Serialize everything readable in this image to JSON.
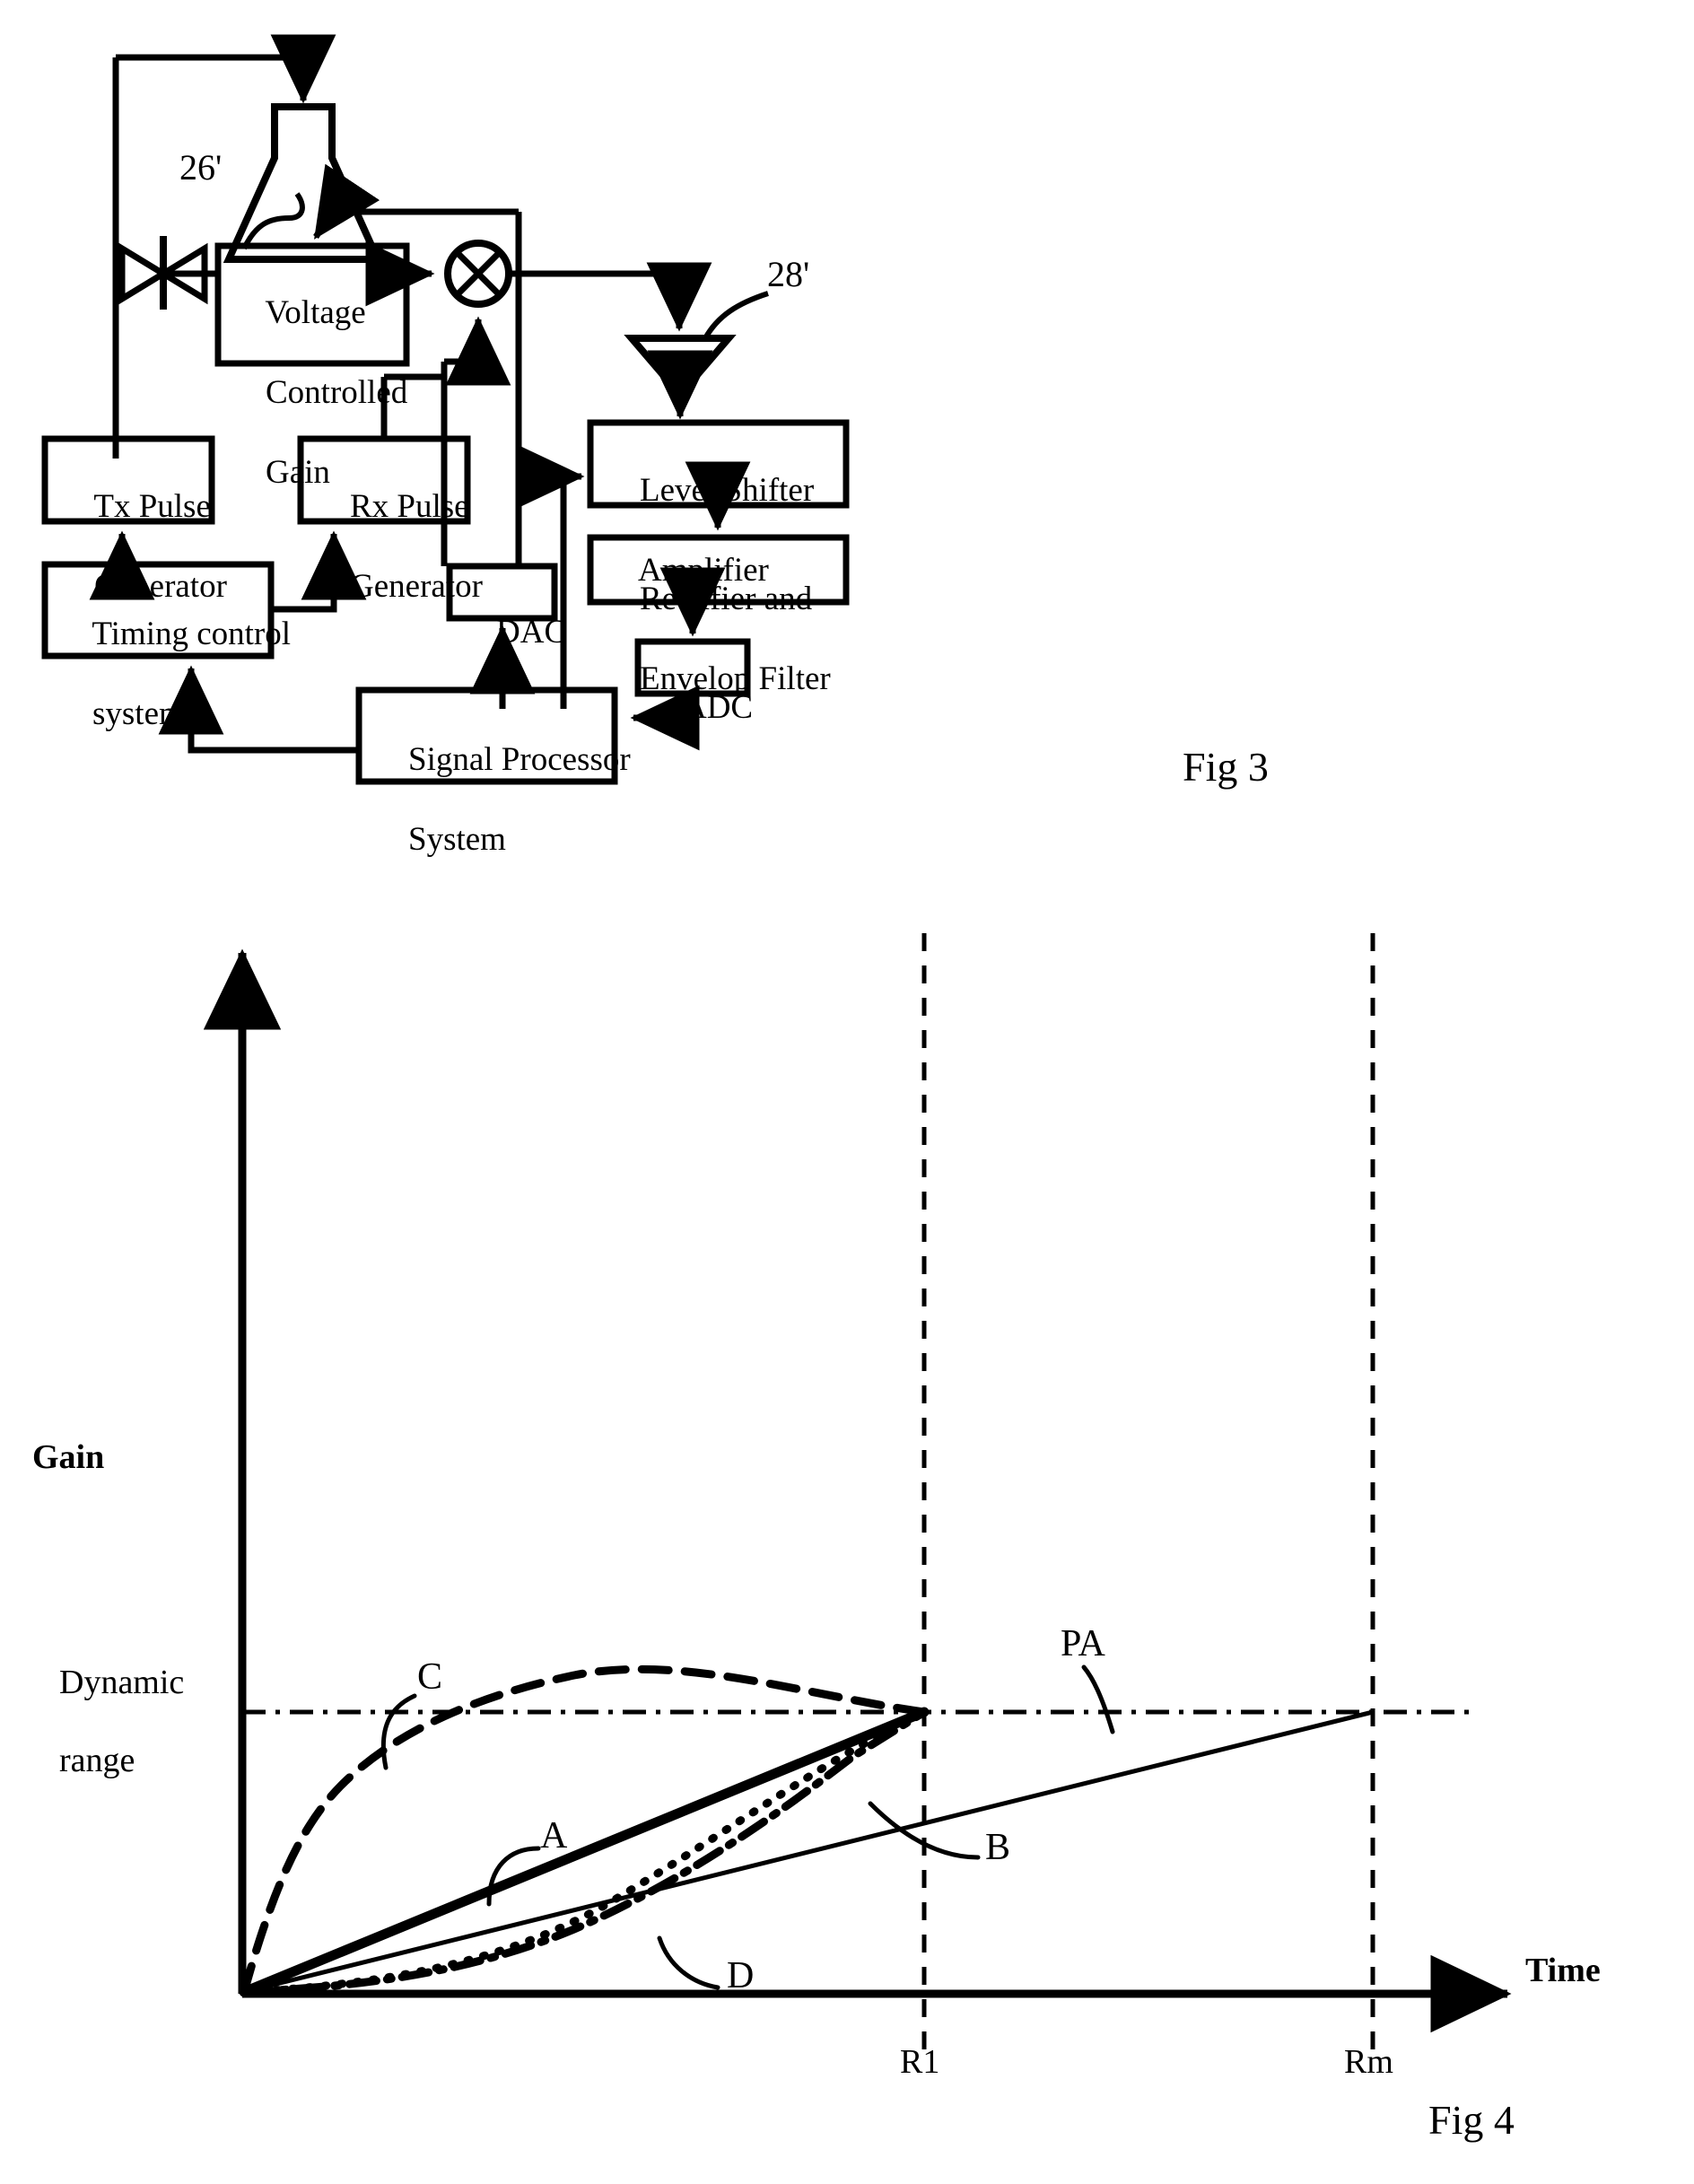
{
  "figure3": {
    "caption": "Fig 3",
    "ref_labels": [
      {
        "id": "ref-26",
        "text": "26'"
      },
      {
        "id": "ref-28",
        "text": "28'"
      }
    ],
    "blocks": [
      {
        "id": "voltage-controlled-gain",
        "lines": [
          "Voltage",
          "Controlled",
          "Gain"
        ]
      },
      {
        "id": "tx-pulse-generator",
        "lines": [
          "Tx Pulse",
          "Generator"
        ]
      },
      {
        "id": "rx-pulse-generator",
        "lines": [
          "Rx Pulse",
          "Generator"
        ]
      },
      {
        "id": "timing-control-system",
        "lines": [
          "Timing control",
          "system"
        ]
      },
      {
        "id": "dac",
        "lines": [
          "DAC"
        ]
      },
      {
        "id": "level-shifter-amplifier",
        "lines": [
          "Level Shifter",
          "Amplifier"
        ]
      },
      {
        "id": "rectifier-envelop-filter",
        "lines": [
          "Rectifier and",
          "Envelop Filter"
        ]
      },
      {
        "id": "adc",
        "lines": [
          "ADC"
        ]
      },
      {
        "id": "signal-processor-system",
        "lines": [
          "Signal Processor",
          "System"
        ]
      }
    ],
    "symbols": [
      {
        "id": "transducer-horn",
        "name": "transducer-horn-symbol"
      },
      {
        "id": "tr-switch",
        "name": "transmit-receive-switch-symbol"
      },
      {
        "id": "mixer",
        "name": "mixer-symbol"
      },
      {
        "id": "amplifier",
        "name": "amplifier-triangle-symbol"
      }
    ]
  },
  "figure4": {
    "caption": "Fig 4",
    "chart_data": {
      "type": "line",
      "title": "",
      "xlabel": "Time",
      "ylabel": "Gain",
      "xlim": [
        0,
        1.32
      ],
      "ylim": [
        0,
        1.16
      ],
      "grid": false,
      "legend": "inline-annotations",
      "xticks": [
        {
          "label": "R1",
          "value": 0.655
        },
        {
          "label": "Rm",
          "value": 1.105
        }
      ],
      "yticks": [
        {
          "label": "Dynamic range",
          "value": 1.0
        }
      ],
      "annotations": [
        {
          "label": "C",
          "style": "dashed"
        },
        {
          "label": "A",
          "style": "solid-thick"
        },
        {
          "label": "B",
          "style": "dash-dot"
        },
        {
          "label": "D",
          "style": "dotted"
        },
        {
          "label": "PA",
          "style": "solid-thin"
        }
      ],
      "reference_lines": [
        {
          "name": "dynamic-range-line",
          "orientation": "horizontal",
          "value": 1.0,
          "style": "dash-dot"
        },
        {
          "name": "r1-line",
          "orientation": "vertical",
          "value": 0.655,
          "style": "dashed"
        },
        {
          "name": "rm-line",
          "orientation": "vertical",
          "value": 1.105,
          "style": "dashed"
        }
      ],
      "series": [
        {
          "name": "A",
          "style": "solid-thick",
          "description": "linear ramp from origin reaching dynamic range at R1",
          "x": [
            0,
            0.655
          ],
          "y": [
            0,
            1.0
          ]
        },
        {
          "name": "PA",
          "style": "solid-thin",
          "description": "linear ramp from origin reaching dynamic range at Rm",
          "x": [
            0,
            1.105
          ],
          "y": [
            0,
            1.0
          ]
        },
        {
          "name": "C",
          "style": "dashed",
          "description": "logarithmic curve rising quickly then flattening, reaching dynamic range at R1",
          "x": [
            0,
            0.05,
            0.11,
            0.18,
            0.27,
            0.37,
            0.48,
            0.58,
            0.655
          ],
          "y": [
            0,
            0.36,
            0.53,
            0.65,
            0.75,
            0.83,
            0.9,
            0.96,
            1.0
          ]
        },
        {
          "name": "D",
          "style": "dotted",
          "description": "flat then sharply rising exponential curve reaching dynamic range at R1",
          "x": [
            0,
            0.12,
            0.24,
            0.33,
            0.4,
            0.46,
            0.52,
            0.58,
            0.62,
            0.655
          ],
          "y": [
            0,
            0.02,
            0.05,
            0.09,
            0.15,
            0.26,
            0.44,
            0.68,
            0.86,
            1.0
          ]
        },
        {
          "name": "B",
          "style": "dash-dot",
          "description": "slow rise then steep rise reaching dynamic range at R1",
          "x": [
            0,
            0.1,
            0.2,
            0.3,
            0.38,
            0.44,
            0.5,
            0.56,
            0.61,
            0.655
          ],
          "y": [
            0,
            0.04,
            0.08,
            0.13,
            0.2,
            0.3,
            0.45,
            0.65,
            0.84,
            1.0
          ]
        }
      ]
    }
  }
}
